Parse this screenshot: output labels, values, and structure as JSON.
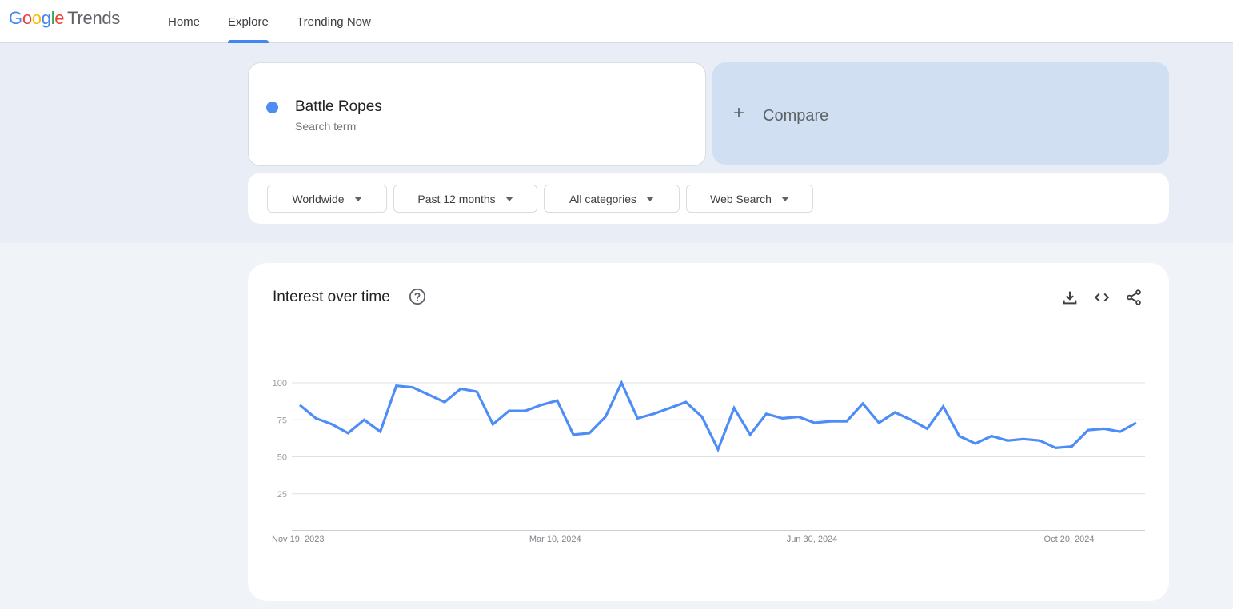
{
  "header": {
    "logo_brand": [
      "G",
      "o",
      "o",
      "g",
      "l",
      "e"
    ],
    "logo_product": "Trends",
    "nav": [
      {
        "label": "Home",
        "active": false
      },
      {
        "label": "Explore",
        "active": true
      },
      {
        "label": "Trending Now",
        "active": false
      }
    ]
  },
  "search": {
    "term": "Battle Ropes",
    "term_type": "Search term",
    "term_color": "#4e8df5",
    "compare_label": "Compare"
  },
  "filters": [
    {
      "label": "Worldwide"
    },
    {
      "label": "Past 12 months"
    },
    {
      "label": "All categories"
    },
    {
      "label": "Web Search"
    }
  ],
  "chart_section": {
    "title": "Interest over time",
    "icons": [
      "help-icon",
      "download-icon",
      "embed-code-icon",
      "share-icon"
    ]
  },
  "chart_data": {
    "type": "line",
    "title": "Interest over time",
    "xlabel": "",
    "ylabel": "",
    "ylim": [
      0,
      100
    ],
    "yticks": [
      25,
      50,
      75,
      100
    ],
    "grid": true,
    "legend": "none",
    "x_tick_labels": [
      {
        "label": "Nov 19, 2023",
        "index": 0
      },
      {
        "label": "Mar 10, 2024",
        "index": 16
      },
      {
        "label": "Jun 30, 2024",
        "index": 32
      },
      {
        "label": "Oct 20, 2024",
        "index": 48
      }
    ],
    "series": [
      {
        "name": "Battle Ropes",
        "color": "#4e8df5",
        "values": [
          85,
          76,
          72,
          66,
          75,
          67,
          98,
          97,
          92,
          87,
          96,
          94,
          72,
          81,
          81,
          85,
          88,
          65,
          66,
          77,
          100,
          76,
          79,
          83,
          87,
          77,
          55,
          83,
          65,
          79,
          76,
          77,
          73,
          74,
          74,
          86,
          73,
          80,
          75,
          69,
          84,
          64,
          59,
          64,
          61,
          62,
          61,
          56,
          57,
          68,
          69,
          67,
          73
        ]
      }
    ]
  }
}
